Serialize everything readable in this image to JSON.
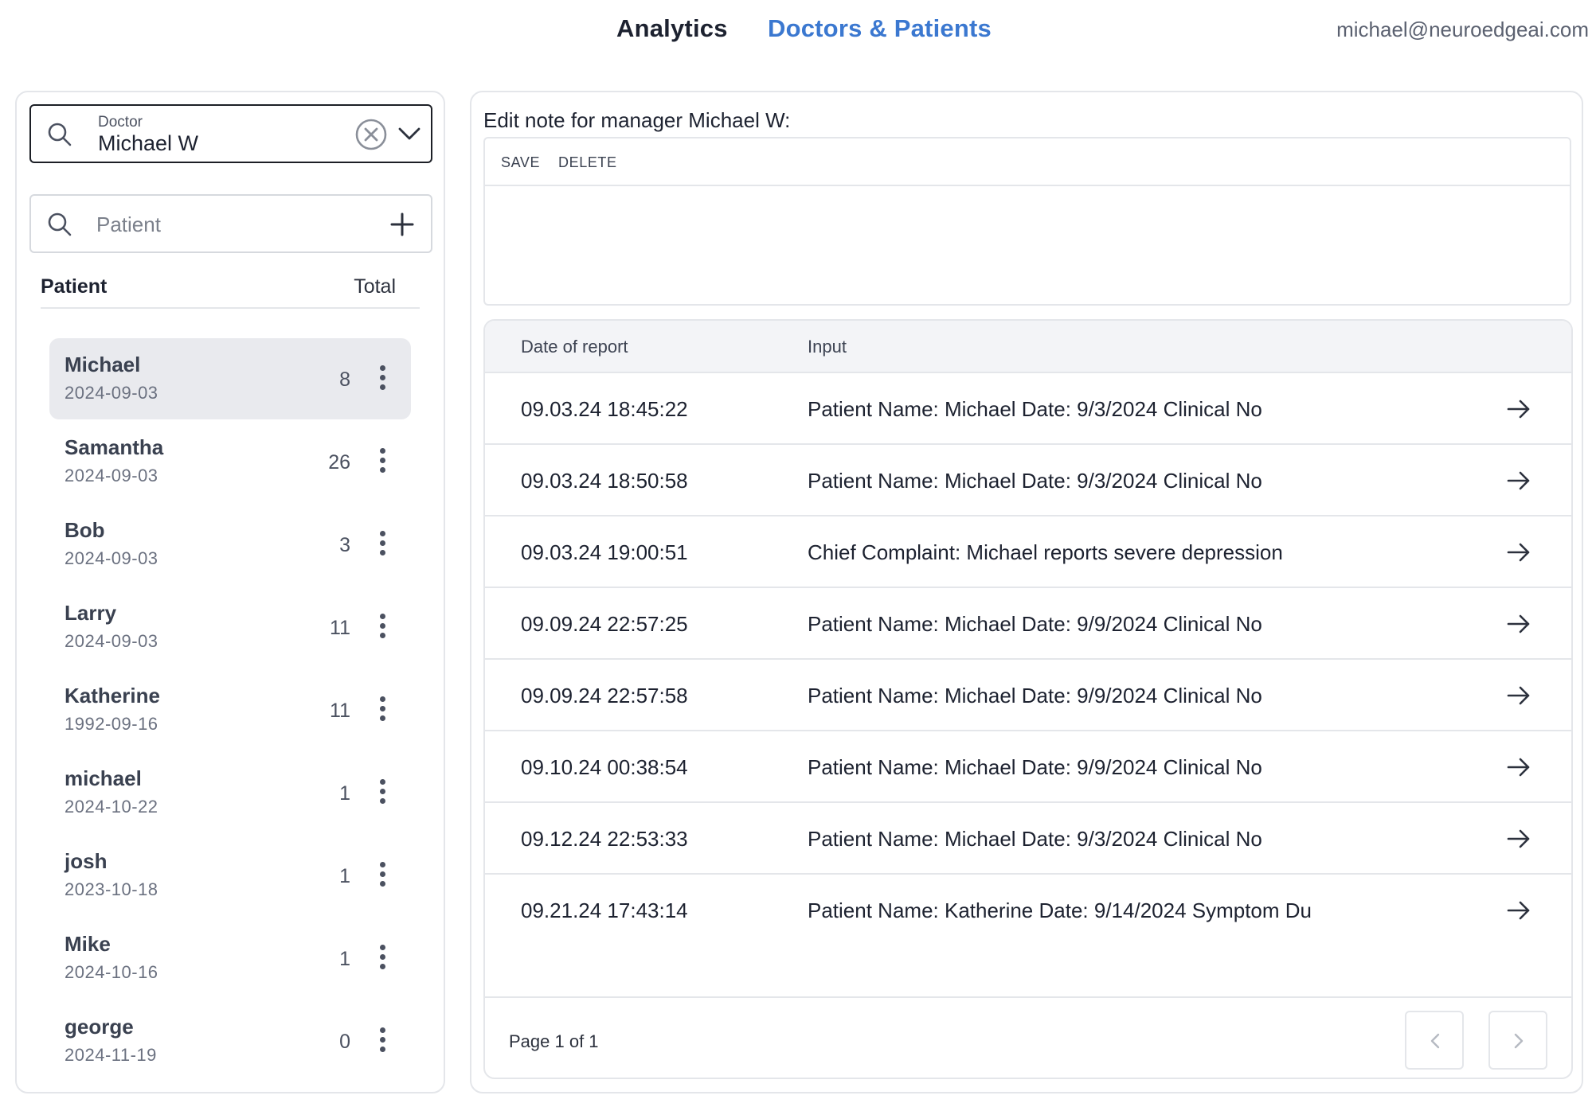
{
  "nav": {
    "tabs": [
      {
        "label": "Analytics",
        "active": false
      },
      {
        "label": "Doctors & Patients",
        "active": true
      }
    ],
    "user_email": "michael@neuroedgeai.com",
    "active_color": "#3b78d0"
  },
  "doctor_select": {
    "label": "Doctor",
    "value": "Michael W",
    "icons": [
      "search-icon",
      "clear-icon",
      "chevron-down-icon"
    ]
  },
  "patient_search": {
    "placeholder": "Patient",
    "value": "",
    "icons": [
      "search-icon",
      "add-icon"
    ]
  },
  "patient_list": {
    "header_patient": "Patient",
    "header_total": "Total",
    "items": [
      {
        "name": "Michael",
        "date": "2024-09-03",
        "total": "8",
        "selected": true
      },
      {
        "name": "Samantha",
        "date": "2024-09-03",
        "total": "26",
        "selected": false
      },
      {
        "name": "Bob",
        "date": "2024-09-03",
        "total": "3",
        "selected": false
      },
      {
        "name": "Larry",
        "date": "2024-09-03",
        "total": "11",
        "selected": false
      },
      {
        "name": "Katherine",
        "date": "1992-09-16",
        "total": "11",
        "selected": false
      },
      {
        "name": "michael",
        "date": "2024-10-22",
        "total": "1",
        "selected": false
      },
      {
        "name": "josh",
        "date": "2023-10-18",
        "total": "1",
        "selected": false
      },
      {
        "name": "Mike",
        "date": "2024-10-16",
        "total": "1",
        "selected": false
      },
      {
        "name": "george",
        "date": "2024-11-19",
        "total": "0",
        "selected": false
      }
    ]
  },
  "note": {
    "title": "Edit note for manager Michael W:",
    "save_label": "SAVE",
    "delete_label": "DELETE",
    "content": ""
  },
  "reports": {
    "col_date": "Date of report",
    "col_input": "Input",
    "rows": [
      {
        "date": "09.03.24 18:45:22",
        "input": "Patient Name: Michael Date: 9/3/2024 Clinical No"
      },
      {
        "date": "09.03.24 18:50:58",
        "input": "Patient Name: Michael Date: 9/3/2024 Clinical No"
      },
      {
        "date": "09.03.24 19:00:51",
        "input": "Chief Complaint: Michael reports severe depression"
      },
      {
        "date": "09.09.24 22:57:25",
        "input": "Patient Name: Michael Date: 9/9/2024 Clinical No"
      },
      {
        "date": "09.09.24 22:57:58",
        "input": "Patient Name: Michael Date: 9/9/2024 Clinical No"
      },
      {
        "date": "09.10.24 00:38:54",
        "input": "Patient Name: Michael Date: 9/9/2024 Clinical No"
      },
      {
        "date": "09.12.24 22:53:33",
        "input": "Patient Name: Michael Date: 9/3/2024 Clinical No"
      },
      {
        "date": "09.21.24 17:43:14",
        "input": "Patient Name: Katherine Date: 9/14/2024 Symptom Du"
      }
    ],
    "row_icon": "arrow-right-icon",
    "pagination": {
      "label": "Page 1 of 1",
      "prev_icon": "chevron-left-icon",
      "next_icon": "chevron-right-icon"
    }
  }
}
